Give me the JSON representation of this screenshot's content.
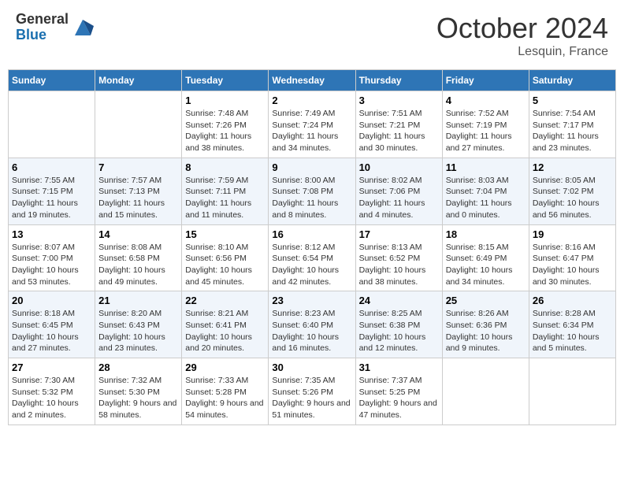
{
  "header": {
    "logo_general": "General",
    "logo_blue": "Blue",
    "month_title": "October 2024",
    "location": "Lesquin, France"
  },
  "weekdays": [
    "Sunday",
    "Monday",
    "Tuesday",
    "Wednesday",
    "Thursday",
    "Friday",
    "Saturday"
  ],
  "weeks": [
    [
      {
        "day": "",
        "info": ""
      },
      {
        "day": "",
        "info": ""
      },
      {
        "day": "1",
        "info": "Sunrise: 7:48 AM\nSunset: 7:26 PM\nDaylight: 11 hours and 38 minutes."
      },
      {
        "day": "2",
        "info": "Sunrise: 7:49 AM\nSunset: 7:24 PM\nDaylight: 11 hours and 34 minutes."
      },
      {
        "day": "3",
        "info": "Sunrise: 7:51 AM\nSunset: 7:21 PM\nDaylight: 11 hours and 30 minutes."
      },
      {
        "day": "4",
        "info": "Sunrise: 7:52 AM\nSunset: 7:19 PM\nDaylight: 11 hours and 27 minutes."
      },
      {
        "day": "5",
        "info": "Sunrise: 7:54 AM\nSunset: 7:17 PM\nDaylight: 11 hours and 23 minutes."
      }
    ],
    [
      {
        "day": "6",
        "info": "Sunrise: 7:55 AM\nSunset: 7:15 PM\nDaylight: 11 hours and 19 minutes."
      },
      {
        "day": "7",
        "info": "Sunrise: 7:57 AM\nSunset: 7:13 PM\nDaylight: 11 hours and 15 minutes."
      },
      {
        "day": "8",
        "info": "Sunrise: 7:59 AM\nSunset: 7:11 PM\nDaylight: 11 hours and 11 minutes."
      },
      {
        "day": "9",
        "info": "Sunrise: 8:00 AM\nSunset: 7:08 PM\nDaylight: 11 hours and 8 minutes."
      },
      {
        "day": "10",
        "info": "Sunrise: 8:02 AM\nSunset: 7:06 PM\nDaylight: 11 hours and 4 minutes."
      },
      {
        "day": "11",
        "info": "Sunrise: 8:03 AM\nSunset: 7:04 PM\nDaylight: 11 hours and 0 minutes."
      },
      {
        "day": "12",
        "info": "Sunrise: 8:05 AM\nSunset: 7:02 PM\nDaylight: 10 hours and 56 minutes."
      }
    ],
    [
      {
        "day": "13",
        "info": "Sunrise: 8:07 AM\nSunset: 7:00 PM\nDaylight: 10 hours and 53 minutes."
      },
      {
        "day": "14",
        "info": "Sunrise: 8:08 AM\nSunset: 6:58 PM\nDaylight: 10 hours and 49 minutes."
      },
      {
        "day": "15",
        "info": "Sunrise: 8:10 AM\nSunset: 6:56 PM\nDaylight: 10 hours and 45 minutes."
      },
      {
        "day": "16",
        "info": "Sunrise: 8:12 AM\nSunset: 6:54 PM\nDaylight: 10 hours and 42 minutes."
      },
      {
        "day": "17",
        "info": "Sunrise: 8:13 AM\nSunset: 6:52 PM\nDaylight: 10 hours and 38 minutes."
      },
      {
        "day": "18",
        "info": "Sunrise: 8:15 AM\nSunset: 6:49 PM\nDaylight: 10 hours and 34 minutes."
      },
      {
        "day": "19",
        "info": "Sunrise: 8:16 AM\nSunset: 6:47 PM\nDaylight: 10 hours and 30 minutes."
      }
    ],
    [
      {
        "day": "20",
        "info": "Sunrise: 8:18 AM\nSunset: 6:45 PM\nDaylight: 10 hours and 27 minutes."
      },
      {
        "day": "21",
        "info": "Sunrise: 8:20 AM\nSunset: 6:43 PM\nDaylight: 10 hours and 23 minutes."
      },
      {
        "day": "22",
        "info": "Sunrise: 8:21 AM\nSunset: 6:41 PM\nDaylight: 10 hours and 20 minutes."
      },
      {
        "day": "23",
        "info": "Sunrise: 8:23 AM\nSunset: 6:40 PM\nDaylight: 10 hours and 16 minutes."
      },
      {
        "day": "24",
        "info": "Sunrise: 8:25 AM\nSunset: 6:38 PM\nDaylight: 10 hours and 12 minutes."
      },
      {
        "day": "25",
        "info": "Sunrise: 8:26 AM\nSunset: 6:36 PM\nDaylight: 10 hours and 9 minutes."
      },
      {
        "day": "26",
        "info": "Sunrise: 8:28 AM\nSunset: 6:34 PM\nDaylight: 10 hours and 5 minutes."
      }
    ],
    [
      {
        "day": "27",
        "info": "Sunrise: 7:30 AM\nSunset: 5:32 PM\nDaylight: 10 hours and 2 minutes."
      },
      {
        "day": "28",
        "info": "Sunrise: 7:32 AM\nSunset: 5:30 PM\nDaylight: 9 hours and 58 minutes."
      },
      {
        "day": "29",
        "info": "Sunrise: 7:33 AM\nSunset: 5:28 PM\nDaylight: 9 hours and 54 minutes."
      },
      {
        "day": "30",
        "info": "Sunrise: 7:35 AM\nSunset: 5:26 PM\nDaylight: 9 hours and 51 minutes."
      },
      {
        "day": "31",
        "info": "Sunrise: 7:37 AM\nSunset: 5:25 PM\nDaylight: 9 hours and 47 minutes."
      },
      {
        "day": "",
        "info": ""
      },
      {
        "day": "",
        "info": ""
      }
    ]
  ]
}
